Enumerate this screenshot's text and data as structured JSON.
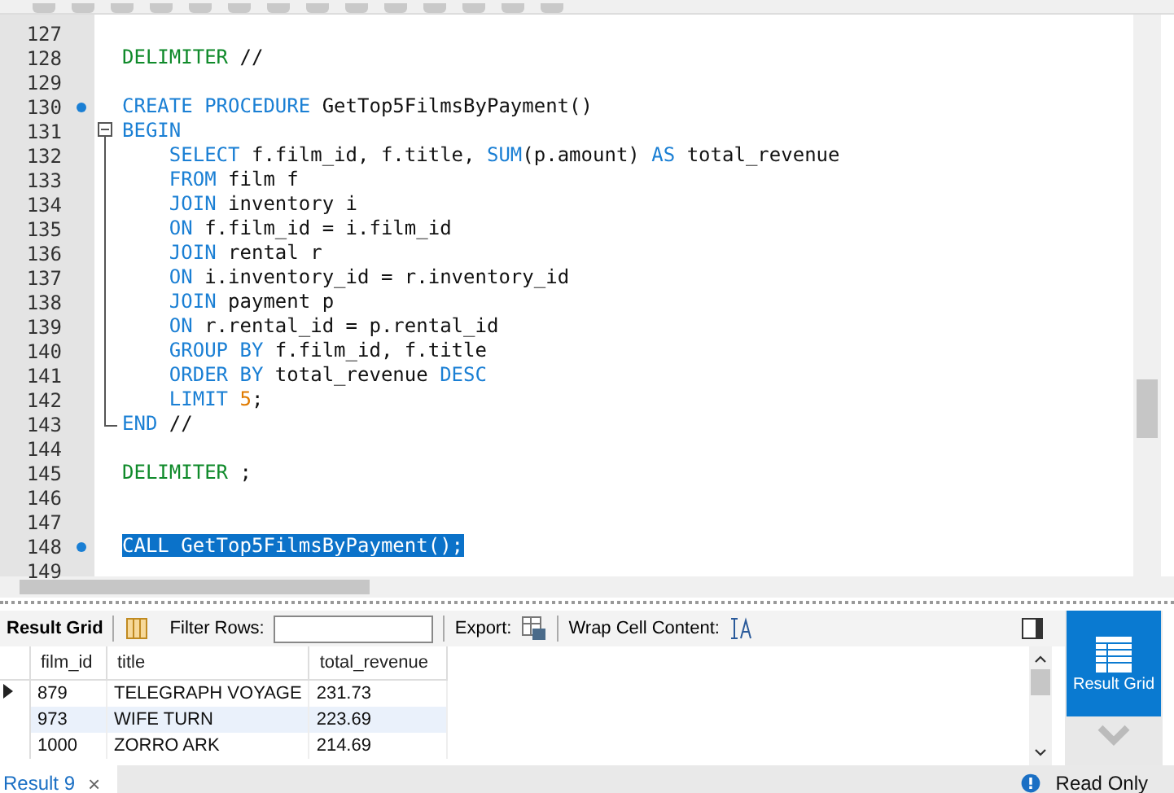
{
  "editor": {
    "lines": [
      {
        "number": "127",
        "marker": false,
        "kind": "code",
        "selected": false
      },
      {
        "number": "128",
        "marker": false,
        "kind": "code",
        "selected": false,
        "tokens": [
          {
            "kind": "delimiter",
            "text": "DELIMITER"
          },
          {
            "kind": "plain",
            "text": " //"
          }
        ]
      },
      {
        "number": "129",
        "marker": false,
        "kind": "code",
        "selected": false
      },
      {
        "number": "130",
        "marker": true,
        "kind": "code",
        "selected": false,
        "tokens": [
          {
            "kind": "keyword",
            "text": "CREATE PROCEDURE"
          },
          {
            "kind": "plain",
            "text": " GetTop5FilmsByPayment()"
          }
        ]
      },
      {
        "number": "131",
        "marker": false,
        "kind": "fold_start",
        "selected": false,
        "tokens": [
          {
            "kind": "keyword",
            "text": "BEGIN"
          }
        ]
      },
      {
        "number": "132",
        "marker": false,
        "kind": "fold_body",
        "selected": false,
        "tokens": [
          {
            "kind": "keyword",
            "text": "    SELECT"
          },
          {
            "kind": "plain",
            "text": " f.film_id, f.title, "
          },
          {
            "kind": "keyword",
            "text": "SUM"
          },
          {
            "kind": "plain",
            "text": "(p.amount) "
          },
          {
            "kind": "keyword",
            "text": "AS"
          },
          {
            "kind": "plain",
            "text": " total_revenue"
          }
        ]
      },
      {
        "number": "133",
        "marker": false,
        "kind": "fold_body",
        "selected": false,
        "tokens": [
          {
            "kind": "keyword",
            "text": "    FROM"
          },
          {
            "kind": "plain",
            "text": " film f"
          }
        ]
      },
      {
        "number": "134",
        "marker": false,
        "kind": "fold_body",
        "selected": false,
        "tokens": [
          {
            "kind": "keyword",
            "text": "    JOIN"
          },
          {
            "kind": "plain",
            "text": " inventory i"
          }
        ]
      },
      {
        "number": "135",
        "marker": false,
        "kind": "fold_body",
        "selected": false,
        "tokens": [
          {
            "kind": "keyword",
            "text": "    ON"
          },
          {
            "kind": "plain",
            "text": " f.film_id = i.film_id"
          }
        ]
      },
      {
        "number": "136",
        "marker": false,
        "kind": "fold_body",
        "selected": false,
        "tokens": [
          {
            "kind": "keyword",
            "text": "    JOIN"
          },
          {
            "kind": "plain",
            "text": " rental r"
          }
        ]
      },
      {
        "number": "137",
        "marker": false,
        "kind": "fold_body",
        "selected": false,
        "tokens": [
          {
            "kind": "keyword",
            "text": "    ON"
          },
          {
            "kind": "plain",
            "text": " i.inventory_id = r.inventory_id"
          }
        ]
      },
      {
        "number": "138",
        "marker": false,
        "kind": "fold_body",
        "selected": false,
        "tokens": [
          {
            "kind": "keyword",
            "text": "    JOIN"
          },
          {
            "kind": "plain",
            "text": " payment p"
          }
        ]
      },
      {
        "number": "139",
        "marker": false,
        "kind": "fold_body",
        "selected": false,
        "tokens": [
          {
            "kind": "keyword",
            "text": "    ON"
          },
          {
            "kind": "plain",
            "text": " r.rental_id = p.rental_id"
          }
        ]
      },
      {
        "number": "140",
        "marker": false,
        "kind": "fold_body",
        "selected": false,
        "tokens": [
          {
            "kind": "keyword",
            "text": "    GROUP BY"
          },
          {
            "kind": "plain",
            "text": " f.film_id, f.title"
          }
        ]
      },
      {
        "number": "141",
        "marker": false,
        "kind": "fold_body",
        "selected": false,
        "tokens": [
          {
            "kind": "keyword",
            "text": "    ORDER BY"
          },
          {
            "kind": "plain",
            "text": " total_revenue "
          },
          {
            "kind": "keyword",
            "text": "DESC"
          }
        ]
      },
      {
        "number": "142",
        "marker": false,
        "kind": "fold_body",
        "selected": false,
        "tokens": [
          {
            "kind": "keyword",
            "text": "    LIMIT"
          },
          {
            "kind": "number",
            "text": " 5"
          },
          {
            "kind": "plain",
            "text": ";"
          }
        ]
      },
      {
        "number": "143",
        "marker": false,
        "kind": "fold_end",
        "selected": false,
        "tokens": [
          {
            "kind": "keyword",
            "text": "END"
          },
          {
            "kind": "plain",
            "text": " //"
          }
        ]
      },
      {
        "number": "144",
        "marker": false,
        "kind": "code",
        "selected": false
      },
      {
        "number": "145",
        "marker": false,
        "kind": "code",
        "selected": false,
        "tokens": [
          {
            "kind": "delimiter",
            "text": "DELIMITER"
          },
          {
            "kind": "plain",
            "text": " ;"
          }
        ]
      },
      {
        "number": "146",
        "marker": false,
        "kind": "code",
        "selected": false
      },
      {
        "number": "147",
        "marker": false,
        "kind": "code",
        "selected": false
      },
      {
        "number": "148",
        "marker": true,
        "kind": "code",
        "selected": true,
        "tokens": [
          {
            "kind": "plain",
            "text": "CALL GetTop5FilmsByPayment();"
          }
        ]
      },
      {
        "number": "149",
        "marker": false,
        "kind": "code",
        "selected": false
      }
    ]
  },
  "result_toolbar": {
    "result_grid_label": "Result Grid",
    "filter_label": "Filter Rows:",
    "export_label": "Export:",
    "wrap_label": "Wrap Cell Content:"
  },
  "table": {
    "columns": [
      "film_id",
      "title",
      "total_revenue"
    ],
    "rows": [
      {
        "selected": true,
        "cells": [
          "879",
          "TELEGRAPH VOYAGE",
          "231.73"
        ]
      },
      {
        "selected": false,
        "cells": [
          "973",
          "WIFE TURN",
          "223.69"
        ]
      },
      {
        "selected": false,
        "cells": [
          "1000",
          "ZORRO ARK",
          "214.69"
        ]
      }
    ]
  },
  "side_panel": {
    "label": "Result Grid"
  },
  "status_bar": {
    "tab": "Result 9",
    "close": "×",
    "status": "Read Only"
  }
}
